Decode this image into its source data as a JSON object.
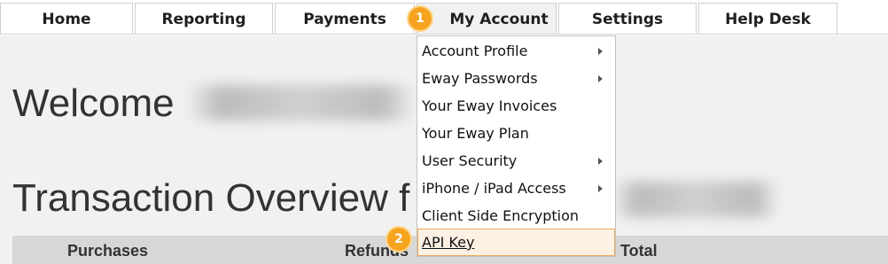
{
  "tabs": [
    {
      "label": "Home"
    },
    {
      "label": "Reporting"
    },
    {
      "label": "Payments"
    },
    {
      "label": "My Account"
    },
    {
      "label": "Settings"
    },
    {
      "label": "Help Desk"
    }
  ],
  "page": {
    "welcome": "Welcome",
    "overview_title": "Transaction Overview f"
  },
  "table": {
    "headers": [
      "Purchases",
      "Refunds",
      "Total"
    ]
  },
  "menu": {
    "items": [
      {
        "label": "Account Profile",
        "submenu": true
      },
      {
        "label": "Eway Passwords",
        "submenu": true
      },
      {
        "label": "Your Eway Invoices",
        "submenu": false
      },
      {
        "label": "Your Eway Plan",
        "submenu": false
      },
      {
        "label": "User Security",
        "submenu": true
      },
      {
        "label": "iPhone / iPad Access",
        "submenu": true
      },
      {
        "label": "Client Side Encryption",
        "submenu": false
      },
      {
        "label": "API Key",
        "submenu": false,
        "highlighted": true
      }
    ]
  },
  "annotations": {
    "step1": "1",
    "step2": "2"
  },
  "colors": {
    "badge": "#f6a41f",
    "highlight_border": "#f1a85a",
    "highlight_bg": "#fdf1e4"
  }
}
